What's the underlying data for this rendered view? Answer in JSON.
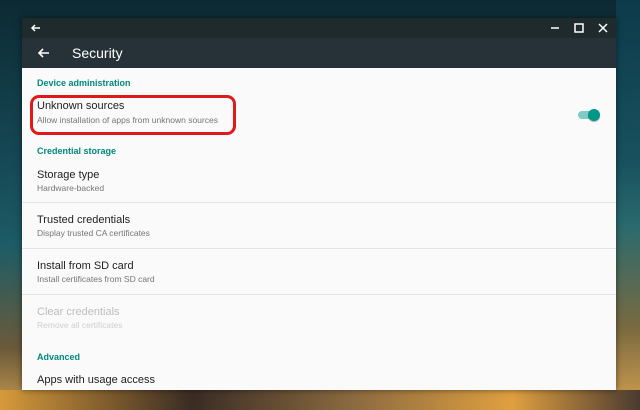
{
  "window": {
    "title": "Security"
  },
  "sections": {
    "device_admin": "Device administration",
    "credential_storage": "Credential storage",
    "advanced": "Advanced"
  },
  "prefs": {
    "unknown_sources": {
      "title": "Unknown sources",
      "summary": "Allow installation of apps from unknown sources",
      "enabled": true
    },
    "storage_type": {
      "title": "Storage type",
      "summary": "Hardware-backed"
    },
    "trusted_credentials": {
      "title": "Trusted credentials",
      "summary": "Display trusted CA certificates"
    },
    "install_sd": {
      "title": "Install from SD card",
      "summary": "Install certificates from SD card"
    },
    "clear_credentials": {
      "title": "Clear credentials",
      "summary": "Remove all certificates",
      "disabled": true
    },
    "usage_access": {
      "title": "Apps with usage access"
    }
  },
  "colors": {
    "accent": "#00897b",
    "toolbar": "#263238",
    "highlight": "#e01a1a",
    "switch_on": "#009688"
  },
  "icons": {
    "chrome_back": "arrow-left-icon",
    "minimize": "minimize-icon",
    "maximize": "maximize-icon",
    "close": "close-icon",
    "app_back": "arrow-left-icon"
  }
}
